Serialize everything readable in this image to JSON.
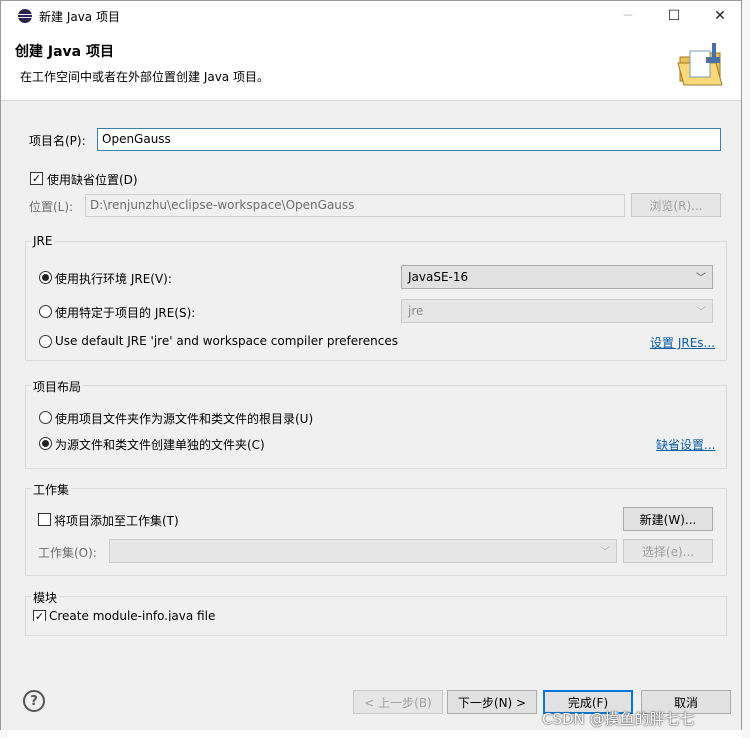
{
  "window": {
    "title": "新建 Java 项目",
    "minimize_glyph": "─",
    "maximize_glyph": "☐",
    "close_glyph": "✕"
  },
  "header": {
    "title": "创建 Java 项目",
    "message": "在工作空间中或者在外部位置创建 Java 项目。"
  },
  "project": {
    "name_label": "项目名(P):",
    "name_value": "OpenGauss",
    "use_default_location_label": "使用缺省位置(D)",
    "use_default_location_checked": true,
    "location_label": "位置(L):",
    "location_value": "D:\\renjunzhu\\eclipse-workspace\\OpenGauss",
    "browse_label": "浏览(R)..."
  },
  "jre": {
    "group_label": "JRE",
    "option_env_label": "使用执行环境 JRE(V):",
    "option_env_value": "JavaSE-16",
    "option_specific_label": "使用特定于项目的 JRE(S):",
    "option_specific_value": "jre",
    "option_default_label": "Use default JRE 'jre' and workspace compiler preferences",
    "configure_link": "设置 JREs..."
  },
  "layout": {
    "group_label": "项目布局",
    "option_root_label": "使用项目文件夹作为源文件和类文件的根目录(U)",
    "option_separate_label": "为源文件和类文件创建单独的文件夹(C)",
    "default_link": "缺省设置..."
  },
  "working_sets": {
    "group_label": "工作集",
    "add_label": "将项目添加至工作集(T)",
    "new_button": "新建(W)...",
    "sets_label": "工作集(O):",
    "select_button": "选择(e)..."
  },
  "module": {
    "group_label": "模块",
    "create_module_info_label": "Create module-info.java file"
  },
  "footer": {
    "help_glyph": "?",
    "back_button": "< 上一步(B)",
    "next_button": "下一步(N) >",
    "finish_button": "完成(F)",
    "cancel_button": "取消"
  },
  "watermark": "CSDN @摸鱼的胖七七",
  "icons": [
    "eclipse-app-icon",
    "new-java-project-wizard-icon",
    "help-icon",
    "checkmark-icon",
    "dropdown-arrow-icon"
  ],
  "colors": {
    "link": "#0b5ea8",
    "focus_border": "#3c7fb1",
    "default_button_border": "#0078d7"
  }
}
